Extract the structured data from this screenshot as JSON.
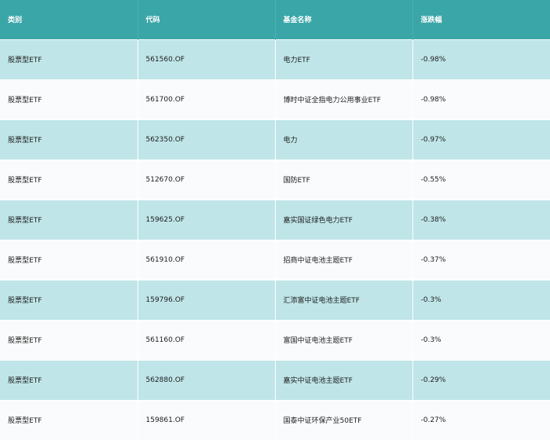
{
  "columns": [
    "类别",
    "代码",
    "基金名称",
    "涨跌幅"
  ],
  "rows": [
    {
      "category": "股票型ETF",
      "code": "561560.OF",
      "name": "电力ETF",
      "change": "-0.98%"
    },
    {
      "category": "股票型ETF",
      "code": "561700.OF",
      "name": "博时中证全指电力公用事业ETF",
      "change": "-0.98%"
    },
    {
      "category": "股票型ETF",
      "code": "562350.OF",
      "name": "电力",
      "change": "-0.97%"
    },
    {
      "category": "股票型ETF",
      "code": "512670.OF",
      "name": "国防ETF",
      "change": "-0.55%"
    },
    {
      "category": "股票型ETF",
      "code": "159625.OF",
      "name": "嘉实国证绿色电力ETF",
      "change": "-0.38%"
    },
    {
      "category": "股票型ETF",
      "code": "561910.OF",
      "name": "招商中证电池主题ETF",
      "change": "-0.37%"
    },
    {
      "category": "股票型ETF",
      "code": "159796.OF",
      "name": "汇添富中证电池主题ETF",
      "change": "-0.3%"
    },
    {
      "category": "股票型ETF",
      "code": "561160.OF",
      "name": "富国中证电池主题ETF",
      "change": "-0.3%"
    },
    {
      "category": "股票型ETF",
      "code": "562880.OF",
      "name": "嘉实中证电池主题ETF",
      "change": "-0.29%"
    },
    {
      "category": "股票型ETF",
      "code": "159861.OF",
      "name": "国泰中证环保产业50ETF",
      "change": "-0.27%"
    }
  ],
  "colors": {
    "header_bg": "#3ba6a8",
    "band_row_bg": "#bfe5e8",
    "plain_row_bg": "#fafbfd"
  }
}
